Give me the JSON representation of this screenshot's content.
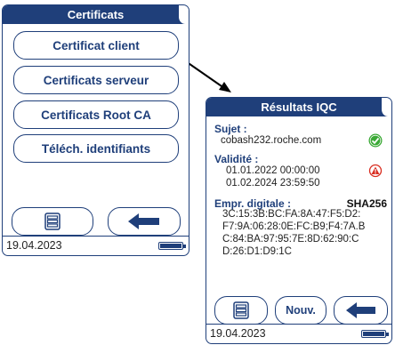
{
  "screen_left": {
    "title": "Certificats",
    "menu_items": [
      {
        "label": "Certificat client"
      },
      {
        "label": "Certificats serveur"
      },
      {
        "label": "Certificats Root CA"
      },
      {
        "label": "Téléch. identifiants"
      }
    ],
    "status_date": "19.04.2023",
    "icons": {
      "menu": "list-menu-icon",
      "back": "arrow-left-icon",
      "battery": "battery-icon"
    }
  },
  "screen_right": {
    "title": "Résultats IQC",
    "subject_label": "Sujet :",
    "subject_value": "cobash232.roche.com",
    "validity_label": "Validité :",
    "validity_from": "01.01.2022 00:00:00",
    "validity_to": "01.02.2024 23:59:50",
    "fingerprint_label": "Empr. digitale :",
    "fingerprint_algo": "SHA256",
    "fingerprint_lines": [
      "3C:15:3B:BC:FA:8A:47:F5:D2:",
      "F7:9A:06:28:0E:FC:B9;F4:7A.B",
      "C:84:BA:97:95:7E:8D:62:90:C",
      "D:26:D1:D9:1C"
    ],
    "new_button": "Nouv.",
    "status_date": "19.04.2023",
    "icons": {
      "valid": "check-circle-icon",
      "expiry": "warning-clock-icon"
    },
    "colors": {
      "valid": "#3aa935",
      "warning": "#d92d20"
    }
  },
  "colors": {
    "primary": "#1f3f7a"
  }
}
